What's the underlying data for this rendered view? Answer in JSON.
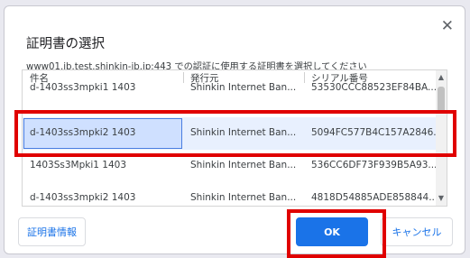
{
  "dialog": {
    "title": "証明書の選択",
    "subtitle": "www01.ib.test.shinkin-ib.jp:443 での認証に使用する証明書を選択してください",
    "close_glyph": "✕"
  },
  "table": {
    "columns": [
      "件名",
      "発行元",
      "シリアル番号"
    ],
    "rows": [
      {
        "subject": "d-1403ss3mpki1 1403",
        "issuer": "Shinkin Internet Ban...",
        "serial": "53530CCC88523EF84BA...",
        "partial": true
      },
      {
        "subject": "d-1403ss3mpki2 1403",
        "issuer": "Shinkin Internet Ban...",
        "serial": "5094FC577B4C157A2846...",
        "selected": true
      },
      {
        "subject": "1403Ss3Mpki1 1403",
        "issuer": "Shinkin Internet Ban...",
        "serial": "536CC6DF73F939B5A93..."
      },
      {
        "subject": "d-1403ss3mpki2 1403",
        "issuer": "Shinkin Internet Ban...",
        "serial": "4818D54885ADE858844..."
      }
    ]
  },
  "buttons": {
    "info": "証明書情報",
    "ok": "OK",
    "cancel": "キャンセル"
  },
  "scrollbar": {
    "up": "▲",
    "down": "▼"
  },
  "highlight_color": "#e00000",
  "accent_color": "#1a73e8"
}
